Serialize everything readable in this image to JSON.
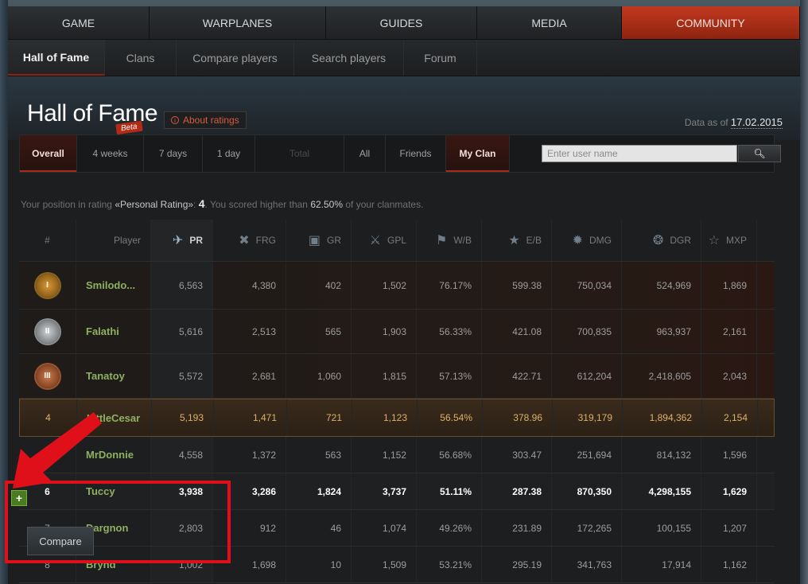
{
  "topnav": [
    {
      "label": "GAME",
      "active": false
    },
    {
      "label": "WARPLANES",
      "active": false
    },
    {
      "label": "GUIDES",
      "active": false
    },
    {
      "label": "MEDIA",
      "active": false
    },
    {
      "label": "COMMUNITY",
      "active": true
    }
  ],
  "subnav": [
    {
      "label": "Hall of Fame",
      "active": true
    },
    {
      "label": "Clans",
      "active": false
    },
    {
      "label": "Compare players",
      "active": false
    },
    {
      "label": "Search players",
      "active": false
    },
    {
      "label": "Forum",
      "active": false
    }
  ],
  "page": {
    "title": "Hall of Fame",
    "beta": "Beta",
    "about": "About ratings",
    "data_as_prefix": "Data as of",
    "data_as_date": "17.02.2015"
  },
  "filters": {
    "period": [
      "Overall",
      "4 weeks",
      "7 days",
      "1 day",
      "Total"
    ],
    "scope": [
      "All",
      "Friends",
      "My Clan"
    ],
    "search_placeholder": "Enter user name",
    "search_icon": "search-icon"
  },
  "position": {
    "pre": "Your position in rating",
    "rating_name": "«Personal Rating»",
    "sep": ":",
    "rank": "4",
    "mid": ". You scored higher than",
    "percent": "62.50%",
    "post": "of your clanmates."
  },
  "table": {
    "headers": [
      {
        "label": "#",
        "icon": ""
      },
      {
        "label": "Player",
        "icon": ""
      },
      {
        "label": "PR",
        "icon": "pr-icon"
      },
      {
        "label": "FRG",
        "icon": "frg-icon"
      },
      {
        "label": "GR",
        "icon": "gr-icon"
      },
      {
        "label": "GPL",
        "icon": "gpl-icon"
      },
      {
        "label": "W/B",
        "icon": "wb-icon"
      },
      {
        "label": "E/B",
        "icon": "eb-icon"
      },
      {
        "label": "DMG",
        "icon": "dmg-icon"
      },
      {
        "label": "DGR",
        "icon": "dgr-icon"
      },
      {
        "label": "MXP",
        "icon": "mxp-icon"
      }
    ],
    "rows": [
      {
        "rank": "I",
        "medal": "gold",
        "player": "Smilodo...",
        "pr": "6,563",
        "frg": "4,380",
        "gr": "402",
        "gpl": "1,502",
        "wb": "76.17%",
        "eb": "599.38",
        "dmg": "750,034",
        "dgr": "524,969",
        "mxp": "1,869"
      },
      {
        "rank": "II",
        "medal": "silver",
        "player": "Falathi",
        "pr": "5,616",
        "frg": "2,513",
        "gr": "565",
        "gpl": "1,903",
        "wb": "56.33%",
        "eb": "421.08",
        "dmg": "700,835",
        "dgr": "963,937",
        "mxp": "2,161"
      },
      {
        "rank": "III",
        "medal": "bronze",
        "player": "Tanatoy",
        "pr": "5,572",
        "frg": "2,681",
        "gr": "1,060",
        "gpl": "1,815",
        "wb": "57.13%",
        "eb": "422.71",
        "dmg": "612,204",
        "dgr": "2,418,605",
        "mxp": "2,043"
      },
      {
        "rank": "4",
        "medal": "",
        "player": "LittleCesar",
        "pr": "5,193",
        "frg": "1,471",
        "gr": "721",
        "gpl": "1,123",
        "wb": "56.54%",
        "eb": "378.96",
        "dmg": "319,179",
        "dgr": "1,894,362",
        "mxp": "2,154"
      },
      {
        "rank": "5",
        "medal": "",
        "player": "MrDonnie",
        "pr": "4,558",
        "frg": "1,372",
        "gr": "563",
        "gpl": "1,152",
        "wb": "56.68%",
        "eb": "303.47",
        "dmg": "251,694",
        "dgr": "814,132",
        "mxp": "1,596"
      },
      {
        "rank": "6",
        "medal": "",
        "player": "Tuccy",
        "pr": "3,938",
        "frg": "3,286",
        "gr": "1,824",
        "gpl": "3,737",
        "wb": "51.11%",
        "eb": "287.38",
        "dmg": "870,350",
        "dgr": "4,298,155",
        "mxp": "1,629"
      },
      {
        "rank": "7",
        "medal": "",
        "player": "Dargnon",
        "pr": "2,803",
        "frg": "912",
        "gr": "46",
        "gpl": "1,074",
        "wb": "49.26%",
        "eb": "231.89",
        "dmg": "172,265",
        "dgr": "100,155",
        "mxp": "1,207"
      },
      {
        "rank": "8",
        "medal": "",
        "player": "Brynd",
        "pr": "1,002",
        "frg": "1,698",
        "gr": "10",
        "gpl": "1,509",
        "wb": "53.21%",
        "eb": "295.19",
        "dmg": "341,763",
        "dgr": "17,914",
        "mxp": "1,162"
      }
    ]
  },
  "overlay": {
    "plus": "+",
    "compare": "Compare"
  }
}
